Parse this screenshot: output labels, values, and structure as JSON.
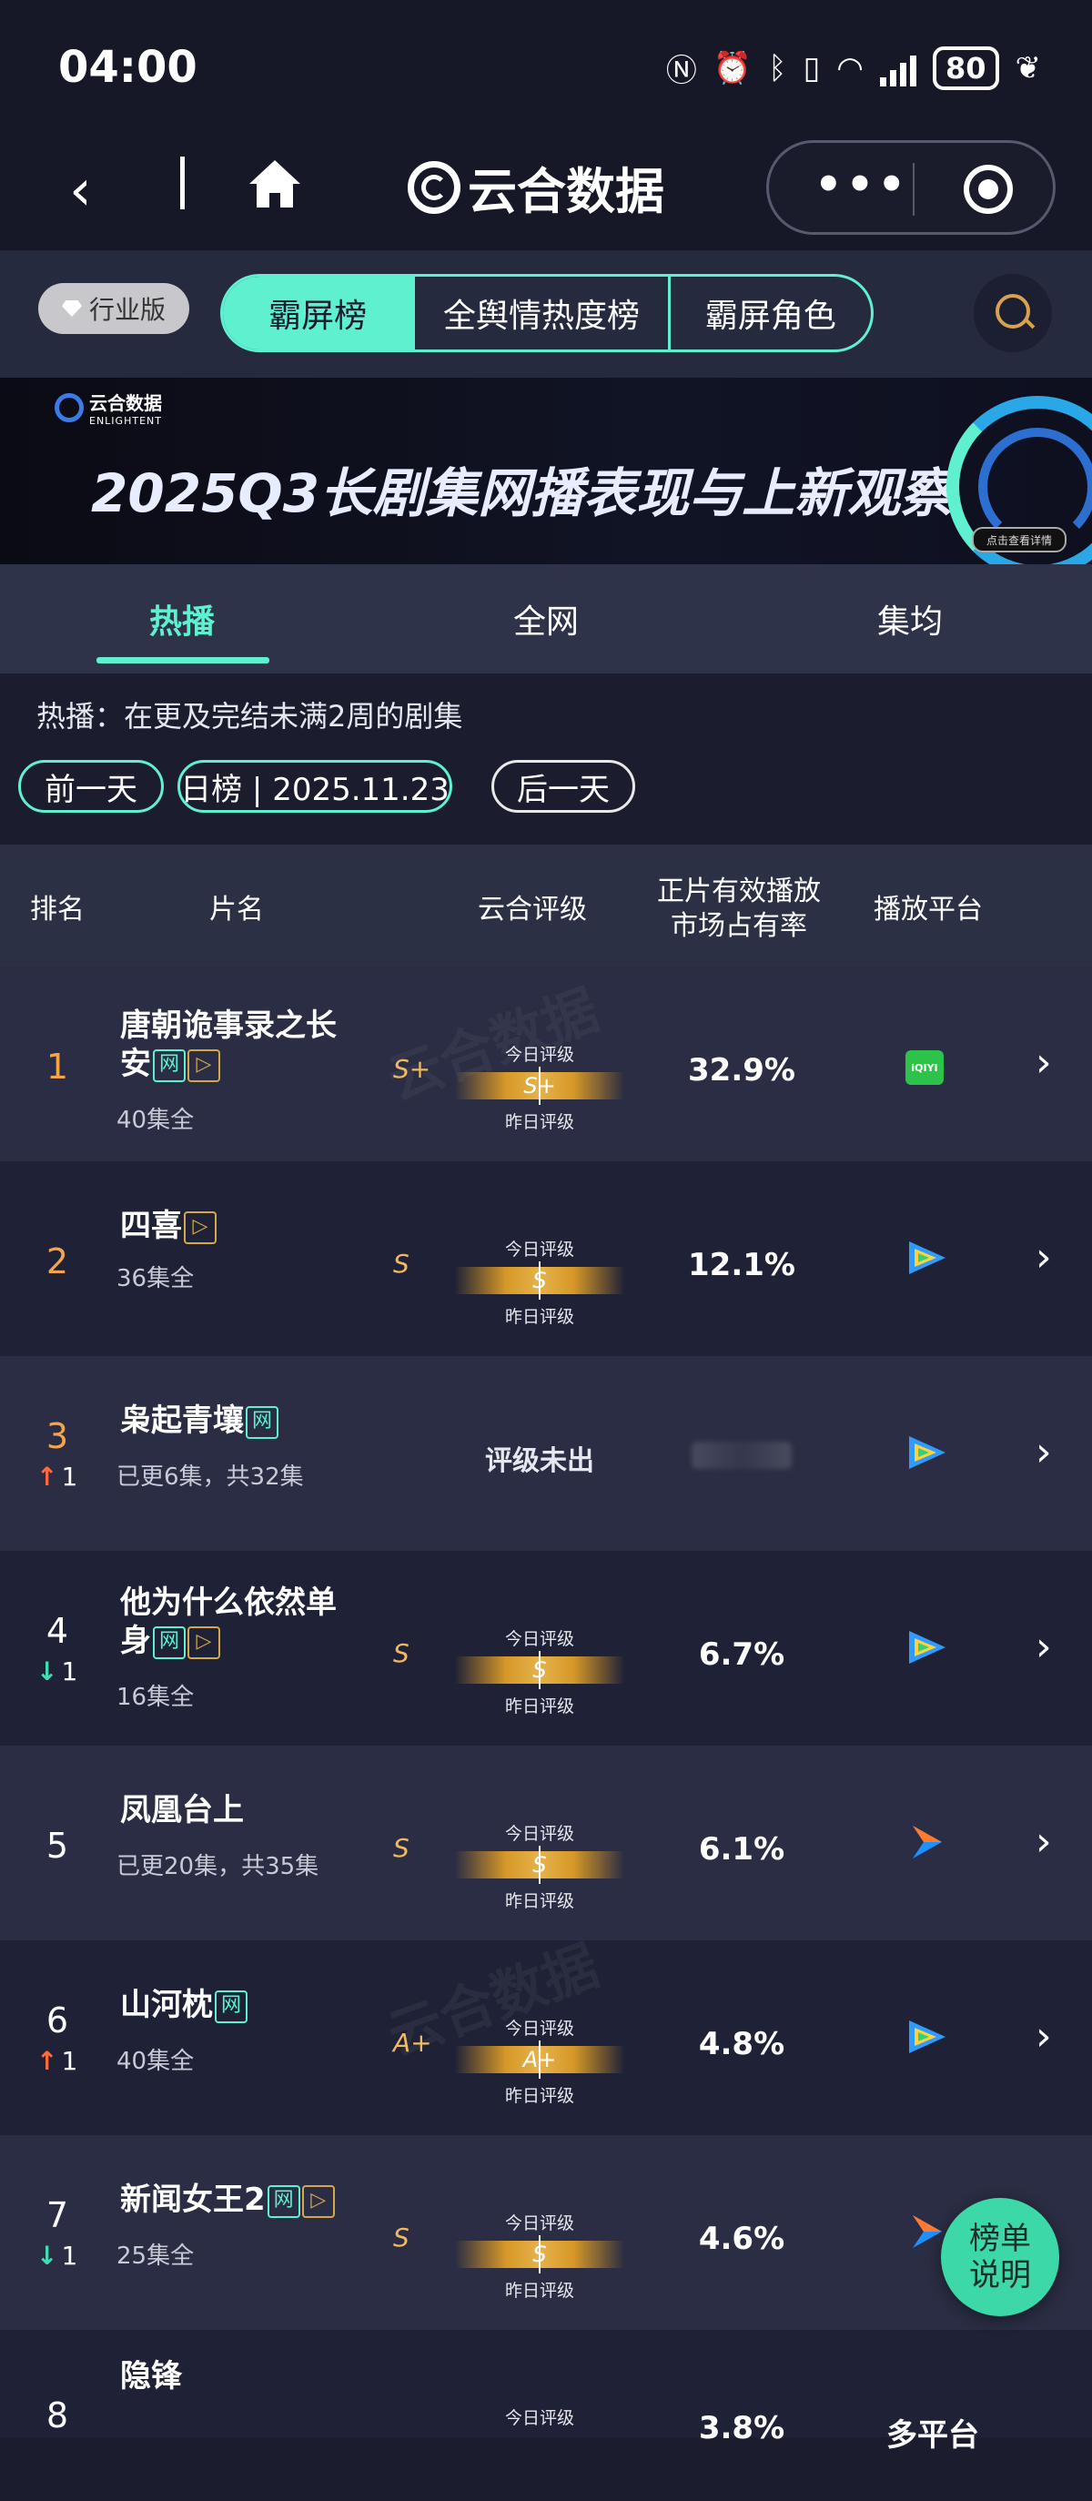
{
  "status_bar": {
    "time": "04:00",
    "battery": "80"
  },
  "nav": {
    "brand": "云合数据"
  },
  "top_tabs": {
    "edition": "行业版",
    "segments": [
      "霸屏榜",
      "全舆情热度榜",
      "霸屏角色"
    ],
    "active_index": 0
  },
  "banner": {
    "logo_cn": "云合数据",
    "logo_en": "ENLIGHTENT",
    "title": "2025Q3长剧集网播表现与上新观察",
    "cta": "点击查看详情"
  },
  "sub_tabs": [
    "热播",
    "全网",
    "集均"
  ],
  "note": "热播：在更及完结未满2周的剧集",
  "date_controls": {
    "prev": "前一天",
    "date": "日榜 | 2025.11.23",
    "next": "后一天"
  },
  "table_header": {
    "rank": "排名",
    "title": "片名",
    "grade": "云合评级",
    "share_line1": "正片有效播放",
    "share_line2": "市场占有率",
    "platform": "播放平台"
  },
  "grade_labels": {
    "today": "今日评级",
    "yesterday": "昨日评级"
  },
  "rows": [
    {
      "rank": "1",
      "title_line1": "唐朝诡事录之长",
      "title_line2": "安",
      "episodes": "40集全",
      "grade": "S+",
      "share": "32.9%",
      "platform": "iqiyi-icon"
    },
    {
      "rank": "2",
      "title_line1": "四喜",
      "title_line2": "",
      "episodes": "36集全",
      "grade": "S",
      "share": "12.1%",
      "platform": "tencent-video-icon"
    },
    {
      "rank": "3",
      "trend": "1",
      "trend_dir": "up",
      "title_line1": "枭起青壤",
      "title_line2": "",
      "episodes": "已更6集，共32集",
      "pending": "评级未出",
      "share": "",
      "platform": "tencent-video-icon"
    },
    {
      "rank": "4",
      "trend": "1",
      "trend_dir": "down",
      "title_line1": "他为什么依然单",
      "title_line2": "身",
      "episodes": "16集全",
      "grade": "S",
      "share": "6.7%",
      "platform": "tencent-video-icon"
    },
    {
      "rank": "5",
      "title_line1": "凤凰台上",
      "title_line2": "",
      "episodes": "已更20集，共35集",
      "grade": "S",
      "share": "6.1%",
      "platform": "youku-icon"
    },
    {
      "rank": "6",
      "trend": "1",
      "trend_dir": "up",
      "title_line1": "山河枕",
      "title_line2": "",
      "episodes": "40集全",
      "grade": "A+",
      "share": "4.8%",
      "platform": "tencent-video-icon"
    },
    {
      "rank": "7",
      "trend": "1",
      "trend_dir": "down",
      "title_line1": "新闻女王2",
      "title_line2": "",
      "episodes": "25集全",
      "grade": "S",
      "share": "4.6%",
      "platform": "youku-icon"
    },
    {
      "rank": "8",
      "title_line1": "隐锋",
      "share": "3.8%",
      "platform_text": "多平台"
    }
  ],
  "float_button": {
    "line1": "榜单",
    "line2": "说明"
  },
  "colors": {
    "accent": "#5ff0d0",
    "gold": "#d69828",
    "rank_top": "#f4a54c",
    "up": "#ff6a3d",
    "down": "#3de0b0"
  }
}
